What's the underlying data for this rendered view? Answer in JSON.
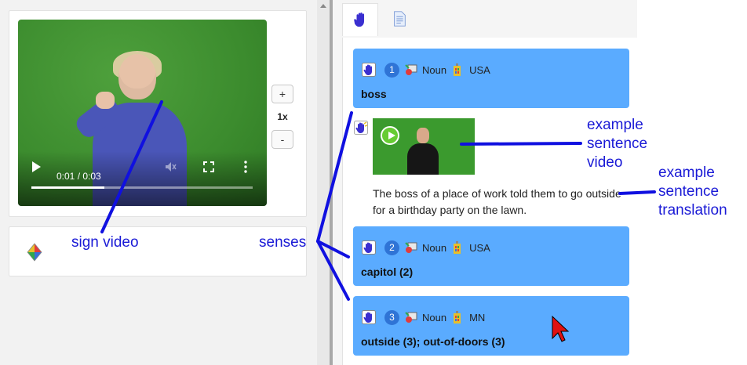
{
  "video": {
    "time": "0:01 / 0:03",
    "progress_fraction": 0.33
  },
  "speed": {
    "plus": "+",
    "label": "1x",
    "minus": "-"
  },
  "tabs": [
    {
      "name": "sign-tab",
      "icon": "hand-icon",
      "active": true
    },
    {
      "name": "document-tab",
      "icon": "document-icon",
      "active": false
    }
  ],
  "senses": [
    {
      "number": "1",
      "pos": "Noun",
      "region": "USA",
      "gloss": "boss"
    },
    {
      "number": "2",
      "pos": "Noun",
      "region": "USA",
      "gloss": "capitol (2)"
    },
    {
      "number": "3",
      "pos": "Noun",
      "region": "MN",
      "gloss": "outside (3); out-of-doors (3)"
    }
  ],
  "example": {
    "translation": "The boss of a place of work told them to go outside for a birthday party on the lawn."
  },
  "annotations": {
    "sign_video": "sign video",
    "senses": "senses",
    "example_video_1": "example",
    "example_video_2": "sentence",
    "example_video_3": "video",
    "example_translation_1": "example",
    "example_translation_2": "sentence",
    "example_translation_3": "translation"
  },
  "colors": {
    "sense_bg": "#5aabff",
    "annotation": "#1a1ad6",
    "number_badge": "#2f74d6"
  }
}
